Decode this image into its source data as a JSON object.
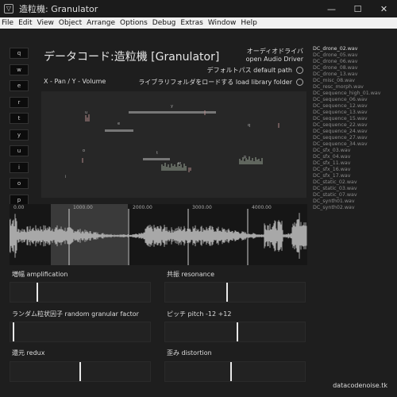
{
  "window": {
    "icon_glyph": "▽",
    "title": "造粒機: Granulator",
    "minimize": "—",
    "maximize": "☐",
    "close": "✕"
  },
  "menu": [
    "File",
    "Edit",
    "View",
    "Object",
    "Arrange",
    "Options",
    "Debug",
    "Extras",
    "Window",
    "Help"
  ],
  "keys": [
    "q",
    "w",
    "e",
    "r",
    "t",
    "y",
    "u",
    "i",
    "o",
    "p"
  ],
  "header": {
    "title": "データコード:造粒機 [Granulator]",
    "driver_jp": "オーディオドライバ",
    "driver_en": "open Audio Driver",
    "default_path": "デフォルトパス default path",
    "load_library": "ライブラリフォルダをロードする load library folder",
    "xy_label": "X - Pan / Y - Volume"
  },
  "files": [
    "DC_drone_02.wav",
    "DC_drone_05.wav",
    "DC_drone_06.wav",
    "DC_drone_08.wav",
    "DC_drone_13.wav",
    "DC_misc_08.wav",
    "DC_resc_morph.wav",
    "DC_sequence_high_01.wav",
    "DC_sequence_06.wav",
    "DC_sequence_12.wav",
    "DC_sequence_13.wav",
    "DC_sequence_15.wav",
    "DC_sequence_22.wav",
    "DC_sequence_24.wav",
    "DC_sequence_27.wav",
    "DC_sequence_34.wav",
    "DC_sfx_03.wav",
    "DC_sfx_04.wav",
    "DC_sfx_11.wav",
    "DC_sfx_16.wav",
    "DC_sfx_17.wav",
    "DC_static_02.wav",
    "DC_static_03.wav",
    "DC_static_07.wav",
    "DC_synth01.wav",
    "DC_synth02.wav"
  ],
  "timeline": [
    "0.00",
    "1000.00",
    "2000.00",
    "3000.00",
    "4000.00"
  ],
  "grain_labels": [
    "q",
    "w",
    "e",
    "r",
    "t",
    "y",
    "u",
    "i",
    "o",
    "p"
  ],
  "params": {
    "amplification": {
      "label": "増幅 amplification",
      "value": 0.19
    },
    "resonance": {
      "label": "共振 resonance",
      "value": 0.44
    },
    "random": {
      "label": "ランダム粒状因子 random granular factor",
      "value": 0.02
    },
    "pitch": {
      "label": "ピッチ pitch -12 +12",
      "value": 0.52
    },
    "redux": {
      "label": "還元 redux",
      "value": 0.5
    },
    "distortion": {
      "label": "歪み distortion",
      "value": 0.47
    }
  },
  "footer": {
    "site": "datacodenoise.tk"
  }
}
